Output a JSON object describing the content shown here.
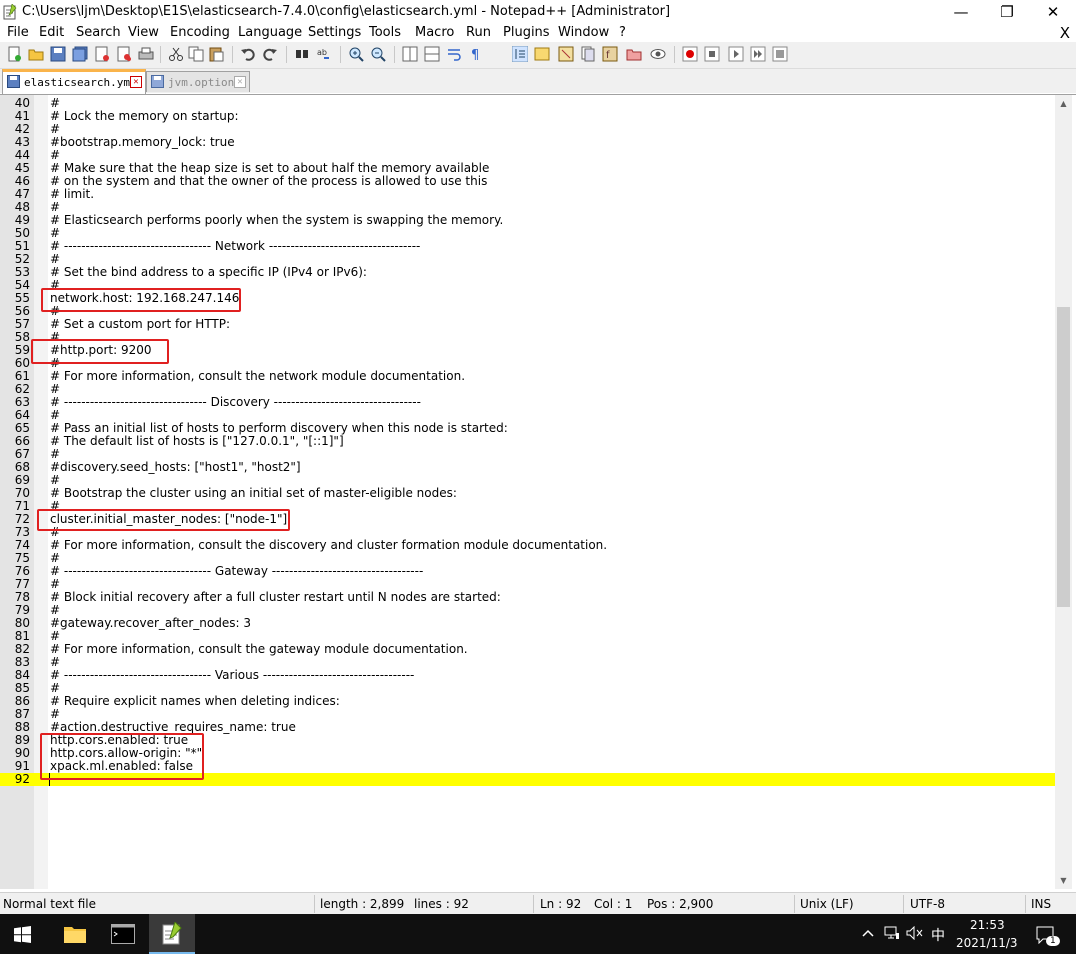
{
  "window": {
    "title": "C:\\Users\\ljm\\Desktop\\E1S\\elasticsearch-7.4.0\\config\\elasticsearch.yml - Notepad++ [Administrator]",
    "minimize": "—",
    "maximize": "❐",
    "close": "✕"
  },
  "menu": {
    "items": [
      "File",
      "Edit",
      "Search",
      "View",
      "Encoding",
      "Language",
      "Settings",
      "Tools",
      "Macro",
      "Run",
      "Plugins",
      "Window",
      "?"
    ],
    "close_doc": "X"
  },
  "tabs": [
    {
      "label": "elasticsearch.yml",
      "active": true
    },
    {
      "label": "jvm.options",
      "active": false
    }
  ],
  "editor": {
    "lines": [
      {
        "n": "40",
        "t": "#"
      },
      {
        "n": "41",
        "t": "# Lock the memory on startup:"
      },
      {
        "n": "42",
        "t": "#"
      },
      {
        "n": "43",
        "t": "#bootstrap.memory_lock: true"
      },
      {
        "n": "44",
        "t": "#"
      },
      {
        "n": "45",
        "t": "# Make sure that the heap size is set to about half the memory available"
      },
      {
        "n": "46",
        "t": "# on the system and that the owner of the process is allowed to use this"
      },
      {
        "n": "47",
        "t": "# limit."
      },
      {
        "n": "48",
        "t": "#"
      },
      {
        "n": "49",
        "t": "# Elasticsearch performs poorly when the system is swapping the memory."
      },
      {
        "n": "50",
        "t": "#"
      },
      {
        "n": "51",
        "t": "# ---------------------------------- Network -----------------------------------"
      },
      {
        "n": "52",
        "t": "#"
      },
      {
        "n": "53",
        "t": "# Set the bind address to a specific IP (IPv4 or IPv6):"
      },
      {
        "n": "54",
        "t": "#"
      },
      {
        "n": "55",
        "t": "network.host: 192.168.247.146"
      },
      {
        "n": "56",
        "t": "#"
      },
      {
        "n": "57",
        "t": "# Set a custom port for HTTP:"
      },
      {
        "n": "58",
        "t": "#"
      },
      {
        "n": "59",
        "t": "#http.port: 9200"
      },
      {
        "n": "60",
        "t": "#"
      },
      {
        "n": "61",
        "t": "# For more information, consult the network module documentation."
      },
      {
        "n": "62",
        "t": "#"
      },
      {
        "n": "63",
        "t": "# --------------------------------- Discovery ----------------------------------"
      },
      {
        "n": "64",
        "t": "#"
      },
      {
        "n": "65",
        "t": "# Pass an initial list of hosts to perform discovery when this node is started:"
      },
      {
        "n": "66",
        "t": "# The default list of hosts is [\"127.0.0.1\", \"[::1]\"]"
      },
      {
        "n": "67",
        "t": "#"
      },
      {
        "n": "68",
        "t": "#discovery.seed_hosts: [\"host1\", \"host2\"]"
      },
      {
        "n": "69",
        "t": "#"
      },
      {
        "n": "70",
        "t": "# Bootstrap the cluster using an initial set of master-eligible nodes:"
      },
      {
        "n": "71",
        "t": "#"
      },
      {
        "n": "72",
        "t": "cluster.initial_master_nodes: [\"node-1\"]"
      },
      {
        "n": "73",
        "t": "#"
      },
      {
        "n": "74",
        "t": "# For more information, consult the discovery and cluster formation module documentation."
      },
      {
        "n": "75",
        "t": "#"
      },
      {
        "n": "76",
        "t": "# ---------------------------------- Gateway -----------------------------------"
      },
      {
        "n": "77",
        "t": "#"
      },
      {
        "n": "78",
        "t": "# Block initial recovery after a full cluster restart until N nodes are started:"
      },
      {
        "n": "79",
        "t": "#"
      },
      {
        "n": "80",
        "t": "#gateway.recover_after_nodes: 3"
      },
      {
        "n": "81",
        "t": "#"
      },
      {
        "n": "82",
        "t": "# For more information, consult the gateway module documentation."
      },
      {
        "n": "83",
        "t": "#"
      },
      {
        "n": "84",
        "t": "# ---------------------------------- Various -----------------------------------"
      },
      {
        "n": "85",
        "t": "#"
      },
      {
        "n": "86",
        "t": "# Require explicit names when deleting indices:"
      },
      {
        "n": "87",
        "t": "#"
      },
      {
        "n": "88",
        "t": "#action.destructive_requires_name: true"
      },
      {
        "n": "89",
        "t": "http.cors.enabled: true"
      },
      {
        "n": "90",
        "t": "http.cors.allow-origin: \"*\""
      },
      {
        "n": "91",
        "t": "xpack.ml.enabled: false"
      },
      {
        "n": "92",
        "t": ""
      }
    ],
    "current_line": "92"
  },
  "statusbar": {
    "file_type": "Normal text file",
    "length": "length : 2,899",
    "lines": "lines : 92",
    "ln": "Ln : 92",
    "col": "Col : 1",
    "pos": "Pos : 2,900",
    "eol": "Unix (LF)",
    "encoding": "UTF-8",
    "ins": "INS"
  },
  "taskbar": {
    "time": "21:53",
    "date": "2021/11/3",
    "ime": "中",
    "notification_count": "1"
  },
  "colors": {
    "highlight_box": "#e02020",
    "current_line": "#ffff00",
    "active_tab_accent": "#fab44b"
  }
}
